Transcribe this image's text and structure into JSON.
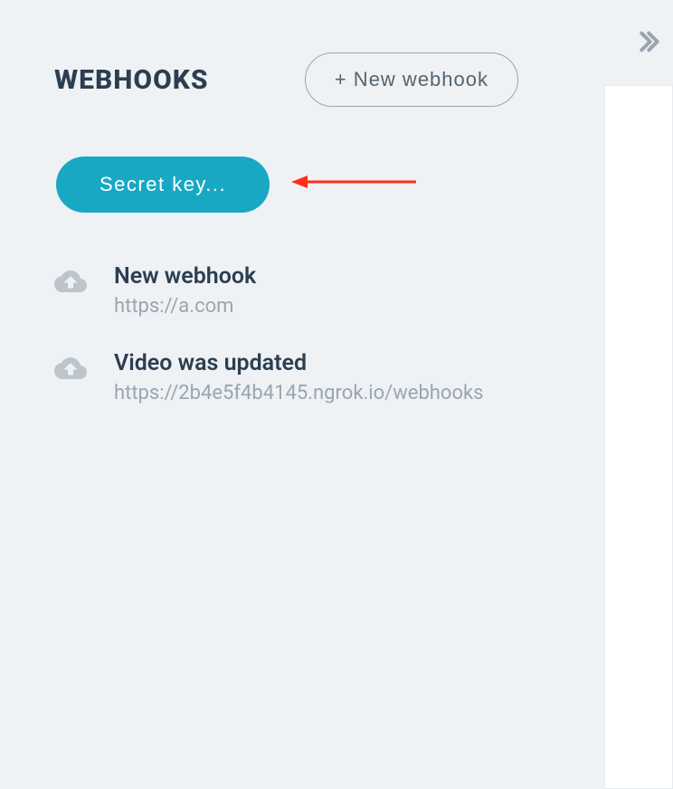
{
  "header": {
    "title": "WEBHOOKS",
    "new_button_label": "+ New webhook"
  },
  "secret_key_label": "Secret key...",
  "webhooks": [
    {
      "name": "New webhook",
      "url": "https://a.com"
    },
    {
      "name": "Video was updated",
      "url": "https://2b4e5f4b4145.ngrok.io/webhooks"
    }
  ],
  "colors": {
    "accent": "#19a8c4",
    "text_dark": "#2c3e50",
    "text_muted": "#9aa5b1",
    "bg": "#eef2f5"
  }
}
